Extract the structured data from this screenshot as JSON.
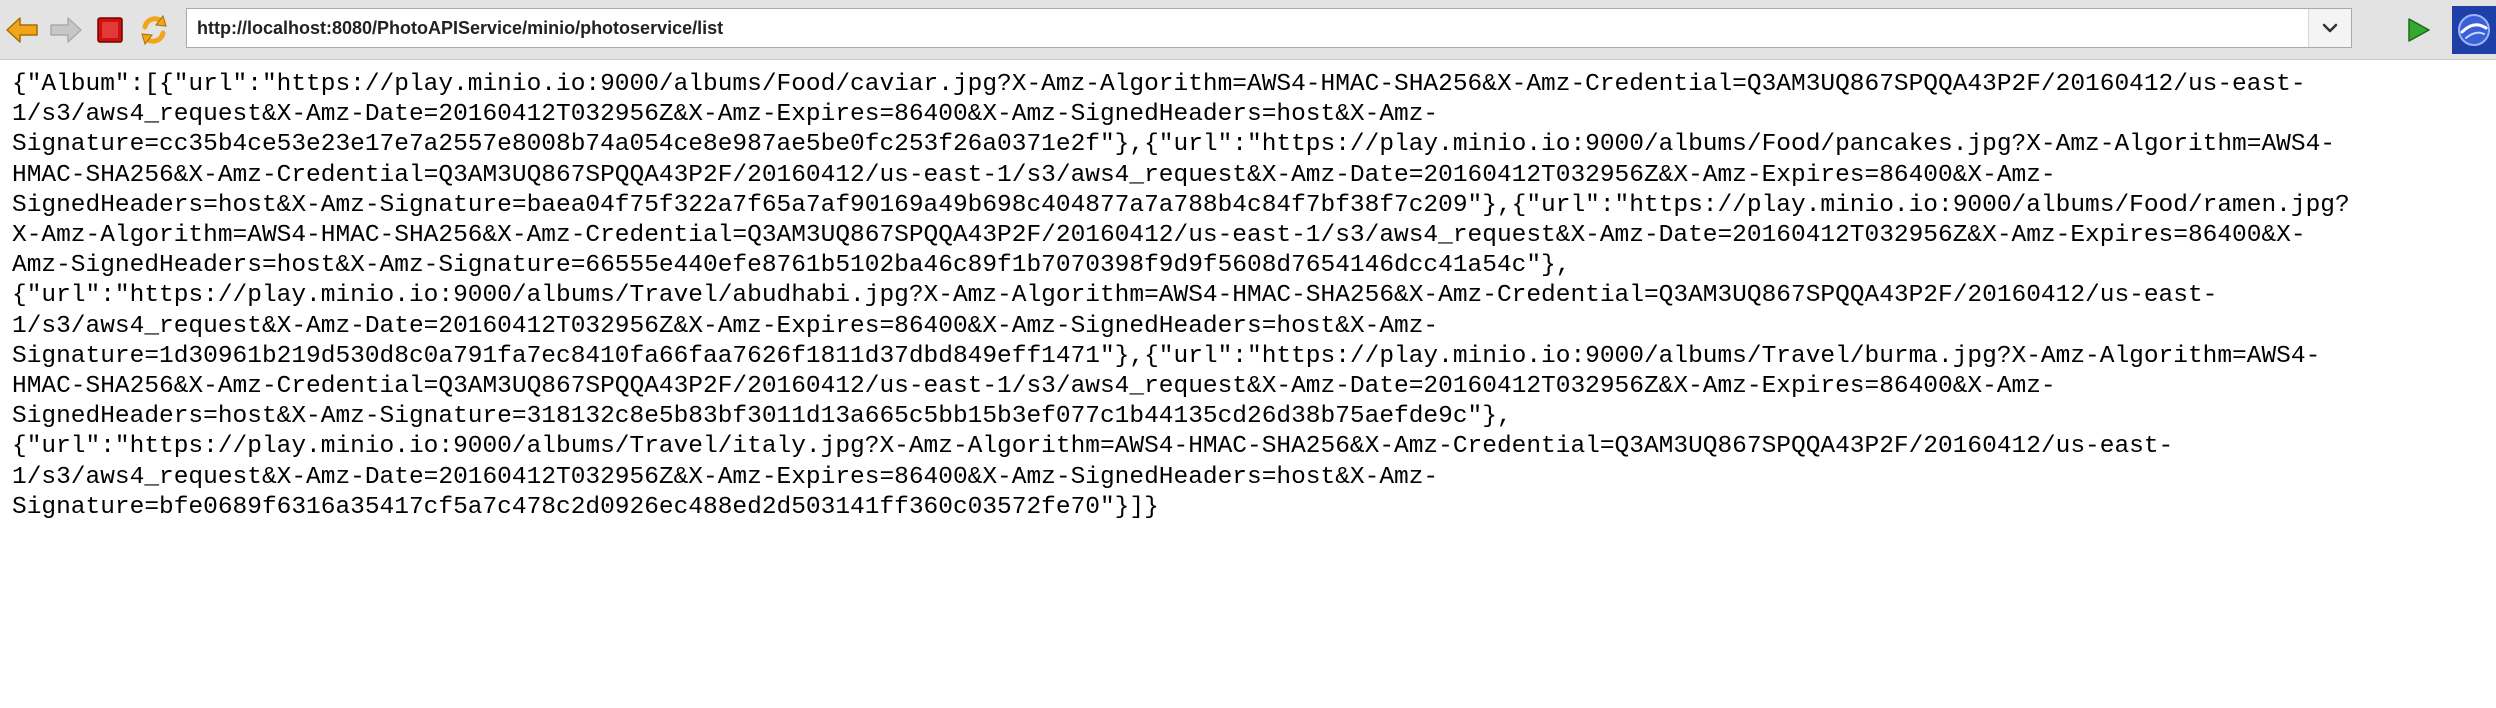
{
  "browser": {
    "url": "http://localhost:8080/PhotoAPIService/minio/photoservice/list",
    "buttons": {
      "back": "arrow-left-icon",
      "forward": "arrow-right-icon",
      "stop": "stop-icon",
      "reload": "reload-icon",
      "dropdown": "chevron-down-icon",
      "go": "play-icon",
      "menu": "logo-icon"
    },
    "colors": {
      "back": "#f2a51b",
      "forward": "#c7c7c7",
      "stop": "#cc1111",
      "reload": "#f2a51b",
      "go": "#35a82f",
      "logo": "#1e3fa8"
    }
  },
  "page": {
    "lines": [
      "{\"Album\":[{\"url\":\"https://play.minio.io:9000/albums/Food/caviar.jpg?X-Amz-Algorithm=AWS4-HMAC-SHA256&X-Amz-Credential=Q3AM3UQ867SPQQA43P2F/20160412/us-east-",
      "1/s3/aws4_request&X-Amz-Date=20160412T032956Z&X-Amz-Expires=86400&X-Amz-SignedHeaders=host&X-Amz-",
      "Signature=cc35b4ce53e23e17e7a2557e8008b74a054ce8e987ae5be0fc253f26a0371e2f\"},{\"url\":\"https://play.minio.io:9000/albums/Food/pancakes.jpg?X-Amz-Algorithm=AWS4-",
      "HMAC-SHA256&X-Amz-Credential=Q3AM3UQ867SPQQA43P2F/20160412/us-east-1/s3/aws4_request&X-Amz-Date=20160412T032956Z&X-Amz-Expires=86400&X-Amz-",
      "SignedHeaders=host&X-Amz-Signature=baea04f75f322a7f65a7af90169a49b698c404877a7a788b4c84f7bf38f7c209\"},{\"url\":\"https://play.minio.io:9000/albums/Food/ramen.jpg?",
      "X-Amz-Algorithm=AWS4-HMAC-SHA256&X-Amz-Credential=Q3AM3UQ867SPQQA43P2F/20160412/us-east-1/s3/aws4_request&X-Amz-Date=20160412T032956Z&X-Amz-Expires=86400&X-",
      "Amz-SignedHeaders=host&X-Amz-Signature=66555e440efe8761b5102ba46c89f1b7070398f9d9f5608d7654146dcc41a54c\"},",
      "{\"url\":\"https://play.minio.io:9000/albums/Travel/abudhabi.jpg?X-Amz-Algorithm=AWS4-HMAC-SHA256&X-Amz-Credential=Q3AM3UQ867SPQQA43P2F/20160412/us-east-",
      "1/s3/aws4_request&X-Amz-Date=20160412T032956Z&X-Amz-Expires=86400&X-Amz-SignedHeaders=host&X-Amz-",
      "Signature=1d30961b219d530d8c0a791fa7ec8410fa66faa7626f1811d37dbd849eff1471\"},{\"url\":\"https://play.minio.io:9000/albums/Travel/burma.jpg?X-Amz-Algorithm=AWS4-",
      "HMAC-SHA256&X-Amz-Credential=Q3AM3UQ867SPQQA43P2F/20160412/us-east-1/s3/aws4_request&X-Amz-Date=20160412T032956Z&X-Amz-Expires=86400&X-Amz-",
      "SignedHeaders=host&X-Amz-Signature=318132c8e5b83bf3011d13a665c5bb15b3ef077c1b44135cd26d38b75aefde9c\"},",
      "{\"url\":\"https://play.minio.io:9000/albums/Travel/italy.jpg?X-Amz-Algorithm=AWS4-HMAC-SHA256&X-Amz-Credential=Q3AM3UQ867SPQQA43P2F/20160412/us-east-",
      "1/s3/aws4_request&X-Amz-Date=20160412T032956Z&X-Amz-Expires=86400&X-Amz-SignedHeaders=host&X-Amz-",
      "Signature=bfe0689f6316a35417cf5a7c478c2d0926ec488ed2d503141ff360c03572fe70\"}]}"
    ]
  }
}
